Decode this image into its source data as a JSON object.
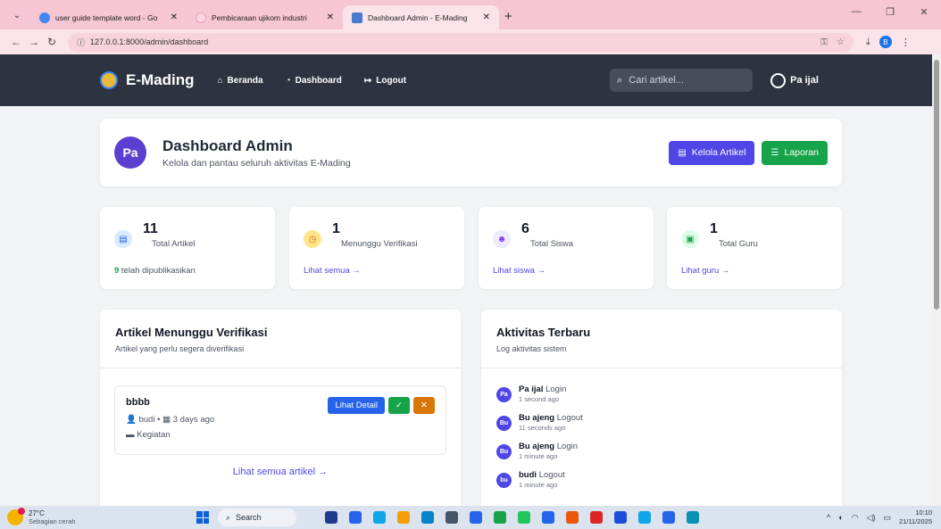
{
  "browser": {
    "tabs": [
      {
        "title": "user guide template word - Go",
        "close": "✕",
        "favicon_color": "#4285f4"
      },
      {
        "title": "Pembicaraan ujikom industri",
        "close": "✕",
        "favicon_color": "#f7b6c6"
      },
      {
        "title": "Dashboard Admin - E-Mading",
        "close": "✕",
        "favicon_color": "#4a7bd0"
      }
    ],
    "new_tab": "+",
    "url": "127.0.0.1:8000/admin/dashboard",
    "profile_initial": "B"
  },
  "nav": {
    "brand": "E-Mading",
    "links": [
      {
        "label": "Beranda",
        "icon": "home-icon",
        "glyph": "⌂"
      },
      {
        "label": "Dashboard",
        "icon": "gauge-icon",
        "glyph": "◔"
      },
      {
        "label": "Logout",
        "icon": "logout-icon",
        "glyph": "↦"
      }
    ],
    "search_placeholder": "Cari artikel...",
    "user_name": "Pa ijal"
  },
  "hero": {
    "avatar": "Pa",
    "title": "Dashboard Admin",
    "subtitle": "Kelola dan pantau seluruh aktivitas E-Mading",
    "btn_kelola": "Kelola Artikel",
    "btn_laporan": "Laporan"
  },
  "stats": [
    {
      "value": "11",
      "label": "Total Artikel",
      "foot_bold": "9",
      "foot_text": " telah dipublikasikan",
      "icon": "newspaper-icon",
      "glyph": "▤",
      "icon_bg": "#dbeafe",
      "icon_color": "#2563eb"
    },
    {
      "value": "1",
      "label": "Menunggu Verifikasi",
      "link": "Lihat semua →",
      "icon": "clock-icon",
      "glyph": "◷",
      "icon_bg": "#fde68a",
      "icon_color": "#ea580c"
    },
    {
      "value": "6",
      "label": "Total Siswa",
      "link": "Lihat siswa →",
      "icon": "users-icon",
      "glyph": "☻",
      "icon_bg": "#ede9fe",
      "icon_color": "#7c3aed"
    },
    {
      "value": "1",
      "label": "Total Guru",
      "link": "Lihat guru →",
      "icon": "teacher-icon",
      "glyph": "▣",
      "icon_bg": "#dcfce7",
      "icon_color": "#16a34a"
    }
  ],
  "pending": {
    "title": "Artikel Menunggu Verifikasi",
    "subtitle": "Artikel yang perlu segera diverifikasi",
    "item": {
      "title": "bbbb",
      "author": "budi",
      "time": "3 days ago",
      "category": "Kegiatan",
      "detail_label": "Lihat Detail",
      "approve": "✓",
      "reject": "✕"
    },
    "see_all": "Lihat semua artikel →"
  },
  "activity": {
    "title": "Aktivitas Terbaru",
    "subtitle": "Log aktivitas sistem",
    "items": [
      {
        "initials": "Pa",
        "user": "Pa ijal",
        "event": "Login",
        "time": "1 second ago"
      },
      {
        "initials": "Bu",
        "user": "Bu ajeng",
        "event": "Logout",
        "time": "11 seconds ago"
      },
      {
        "initials": "Bu",
        "user": "Bu ajeng",
        "event": "Login",
        "time": "1 minute ago"
      },
      {
        "initials": "bu",
        "user": "budi",
        "event": "Logout",
        "time": "1 minute ago"
      }
    ]
  },
  "taskbar": {
    "temp": "27°C",
    "weather": "Sebagian cerah",
    "search": "Search",
    "time": "10:10",
    "date": "21/11/2025",
    "app_colors": [
      "#1e3a8a",
      "#2563eb",
      "#0ea5e9",
      "#f59e0b",
      "#0284c7",
      "#475569",
      "#2563eb",
      "#16a34a",
      "#22c55e",
      "#2563eb",
      "#ea580c",
      "#dc2626",
      "#1d4ed8",
      "#0ea5e9",
      "#2563eb",
      "#0891b2"
    ]
  }
}
